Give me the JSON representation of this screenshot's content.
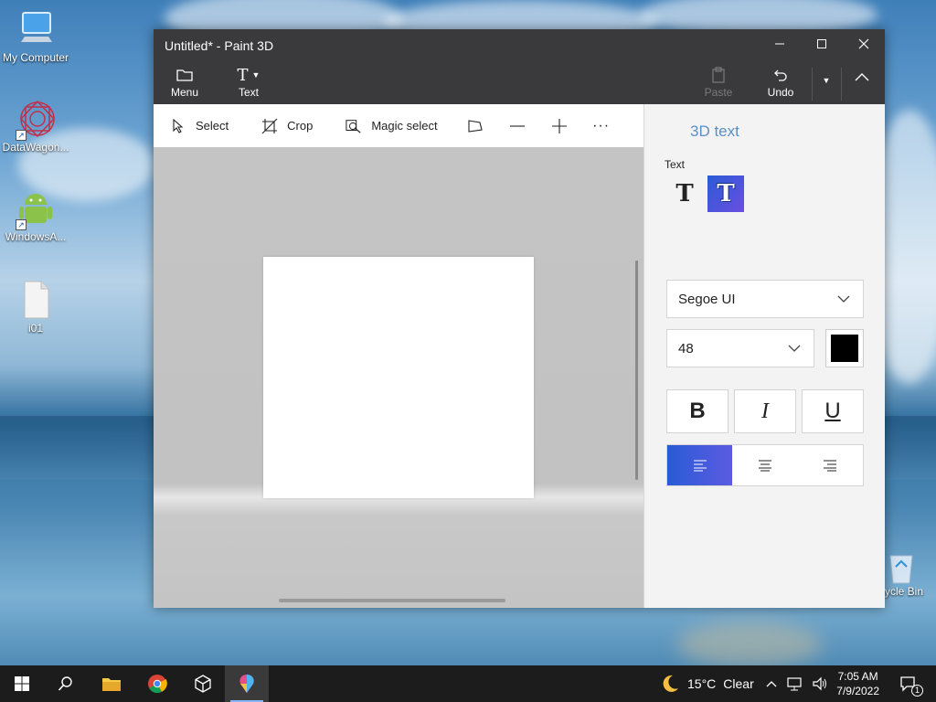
{
  "desktop": {
    "icons": [
      {
        "label": "My Computer",
        "icon": "monitor-icon"
      },
      {
        "label": "DataWagon...",
        "icon": "mandala-icon"
      },
      {
        "label": "WindowsA...",
        "icon": "android-icon"
      },
      {
        "label": "i01",
        "icon": "file-icon"
      }
    ],
    "recycle_bin_label": "cycle Bin"
  },
  "window": {
    "title": "Untitled* - Paint 3D",
    "titlebar_buttons": {
      "menu_label": "Menu",
      "text_label": "Text",
      "paste_label": "Paste",
      "undo_label": "Undo"
    },
    "tools": {
      "select_label": "Select",
      "crop_label": "Crop",
      "magic_select_label": "Magic select"
    },
    "panel": {
      "title": "3D text",
      "text_section_label": "Text",
      "font_family": "Segoe UI",
      "font_size": "48",
      "text_color": "#000000",
      "bold_label": "B",
      "italic_label": "I",
      "underline_label": "U",
      "alignment": "left"
    }
  },
  "taskbar": {
    "weather_temp": "15°C",
    "weather_text": "Clear",
    "time": "7:05 AM",
    "date": "7/9/2022",
    "notification_count": "1"
  },
  "colors": {
    "accent": "#2a5bd7",
    "panel_title": "#5a8fc2",
    "titlebar": "#3a3a3d"
  }
}
